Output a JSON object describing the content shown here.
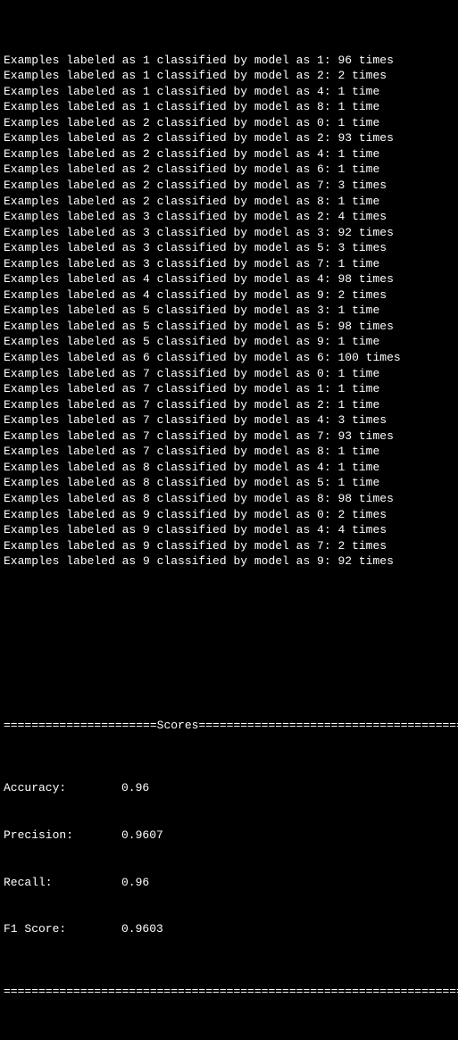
{
  "prefix_a": "Examples labeled as ",
  "prefix_b": " classified by model as ",
  "suffix_one": " time",
  "suffix_many": " times",
  "rows": [
    {
      "true": 1,
      "pred": 1,
      "count": 96
    },
    {
      "true": 1,
      "pred": 2,
      "count": 2
    },
    {
      "true": 1,
      "pred": 4,
      "count": 1
    },
    {
      "true": 1,
      "pred": 8,
      "count": 1
    },
    {
      "true": 2,
      "pred": 0,
      "count": 1
    },
    {
      "true": 2,
      "pred": 2,
      "count": 93
    },
    {
      "true": 2,
      "pred": 4,
      "count": 1
    },
    {
      "true": 2,
      "pred": 6,
      "count": 1
    },
    {
      "true": 2,
      "pred": 7,
      "count": 3
    },
    {
      "true": 2,
      "pred": 8,
      "count": 1
    },
    {
      "true": 3,
      "pred": 2,
      "count": 4
    },
    {
      "true": 3,
      "pred": 3,
      "count": 92
    },
    {
      "true": 3,
      "pred": 5,
      "count": 3
    },
    {
      "true": 3,
      "pred": 7,
      "count": 1
    },
    {
      "true": 4,
      "pred": 4,
      "count": 98
    },
    {
      "true": 4,
      "pred": 9,
      "count": 2
    },
    {
      "true": 5,
      "pred": 3,
      "count": 1
    },
    {
      "true": 5,
      "pred": 5,
      "count": 98
    },
    {
      "true": 5,
      "pred": 9,
      "count": 1
    },
    {
      "true": 6,
      "pred": 6,
      "count": 100
    },
    {
      "true": 7,
      "pred": 0,
      "count": 1
    },
    {
      "true": 7,
      "pred": 1,
      "count": 1
    },
    {
      "true": 7,
      "pred": 2,
      "count": 1
    },
    {
      "true": 7,
      "pred": 4,
      "count": 3
    },
    {
      "true": 7,
      "pred": 7,
      "count": 93
    },
    {
      "true": 7,
      "pred": 8,
      "count": 1
    },
    {
      "true": 8,
      "pred": 4,
      "count": 1
    },
    {
      "true": 8,
      "pred": 5,
      "count": 1
    },
    {
      "true": 8,
      "pred": 8,
      "count": 98
    },
    {
      "true": 9,
      "pred": 0,
      "count": 2
    },
    {
      "true": 9,
      "pred": 4,
      "count": 4
    },
    {
      "true": 9,
      "pred": 7,
      "count": 2
    },
    {
      "true": 9,
      "pred": 9,
      "count": 92
    }
  ],
  "scores_header_word": "Scores",
  "rule_char": "=",
  "scores": {
    "accuracy_label": "Accuracy:",
    "accuracy_value": "0.96",
    "precision_label": "Precision:",
    "precision_value": "0.9607",
    "recall_label": "Recall:",
    "recall_value": "0.96",
    "f1_label": "F1 Score:",
    "f1_value": "0.9603"
  }
}
